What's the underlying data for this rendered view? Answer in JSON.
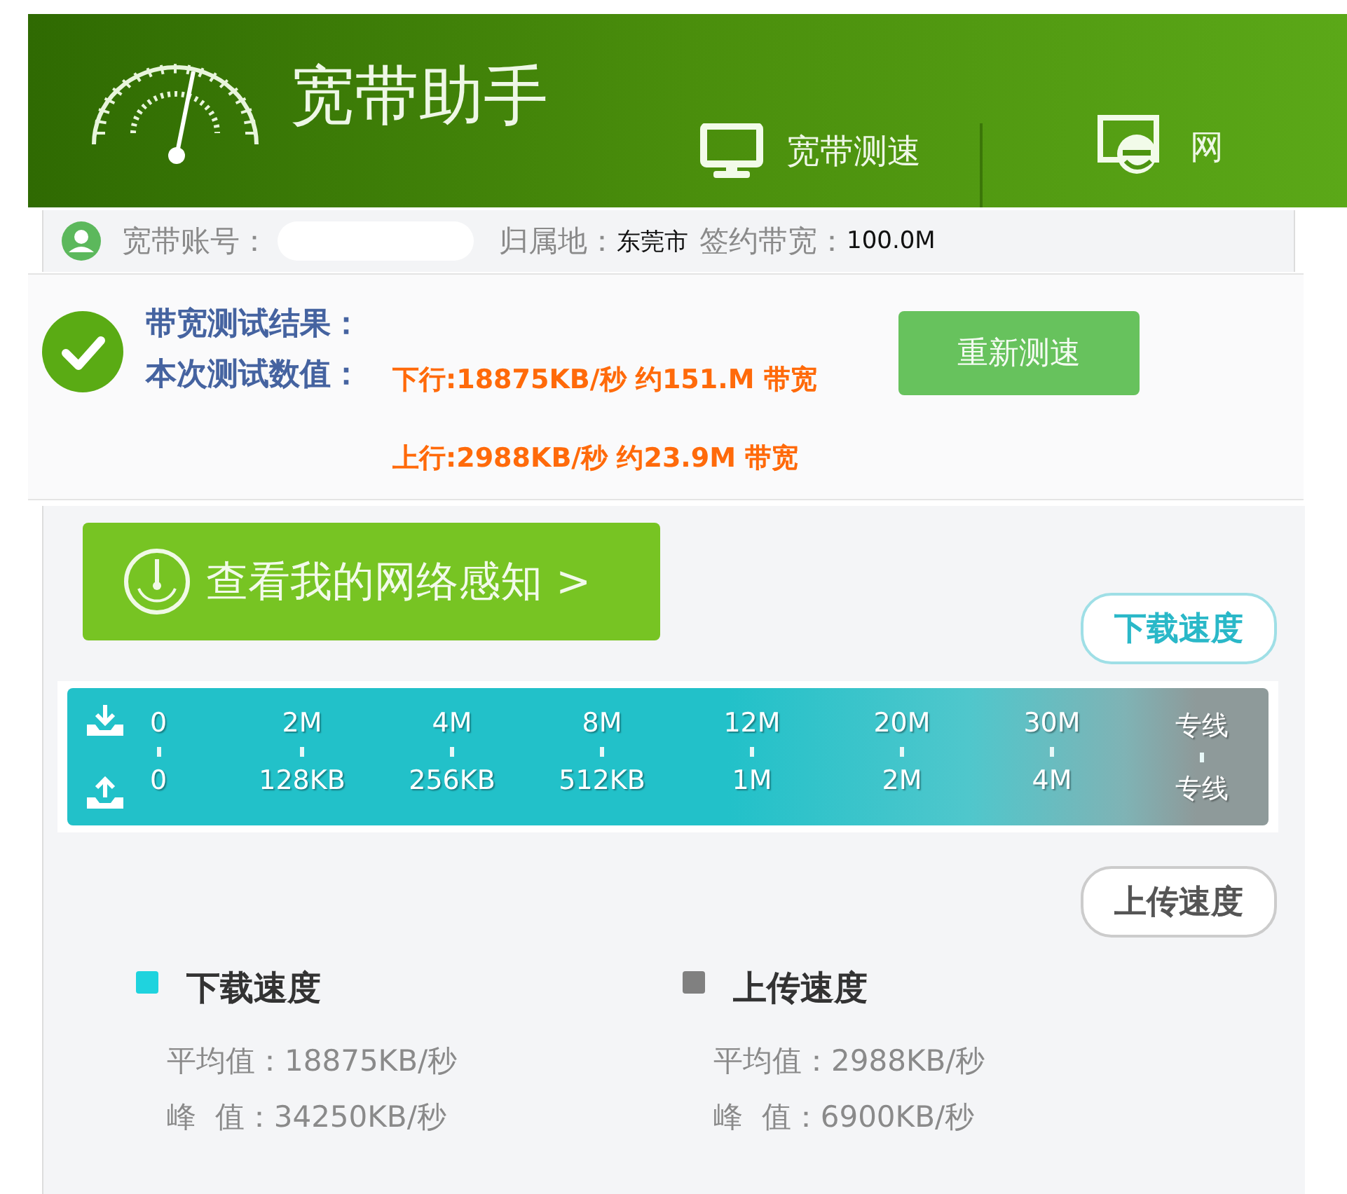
{
  "app": {
    "title": "宽带助手"
  },
  "tabs": [
    {
      "label": "宽带测速",
      "kind": "monitor"
    },
    {
      "label": "网",
      "kind": "browser"
    }
  ],
  "account_bar": {
    "account_label": "宽带账号：",
    "region_label": "归属地：",
    "region": "东莞市",
    "bandwidth_label": "签约带宽：",
    "bandwidth": "100.0M"
  },
  "result": {
    "title": "带宽测试结果：",
    "values_label": "本次测试数值：",
    "download": "下行:18875KB/秒 约151.M 带宽",
    "upload": "上行:2988KB/秒 约23.9M 带宽",
    "retest_button": "重新测速"
  },
  "network_button": {
    "label": "查看我的网络感知 >"
  },
  "scale": {
    "download_tip": "下载速度",
    "upload_tip": "上传速度",
    "download_labels": [
      "0",
      "2M",
      "4M",
      "8M",
      "12M",
      "20M",
      "30M",
      "专线"
    ],
    "upload_labels": [
      "0",
      "128KB",
      "256KB",
      "512KB",
      "1M",
      "2M",
      "4M",
      "专线"
    ]
  },
  "legend": [
    {
      "title": "下载速度",
      "color": "#1fd3de",
      "average": "平均值：18875KB/秒",
      "peak": "峰  值：34250KB/秒"
    },
    {
      "title": "上传速度",
      "color": "#808080",
      "average": "平均值：2988KB/秒",
      "peak": "峰  值：6900KB/秒"
    }
  ]
}
